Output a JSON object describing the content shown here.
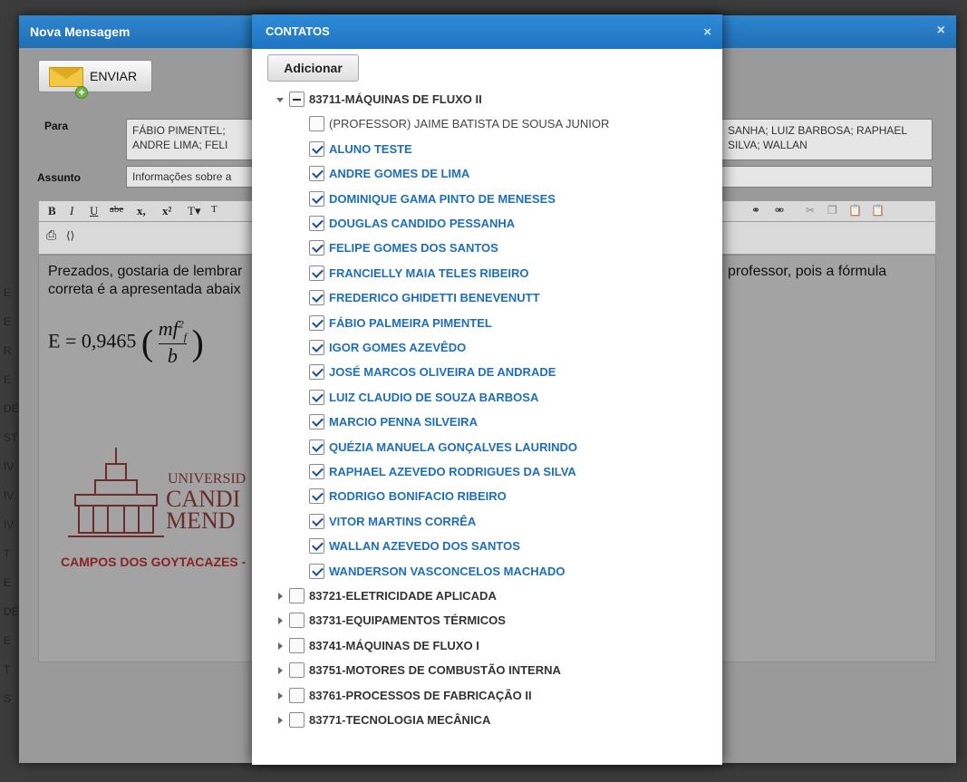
{
  "background": {
    "letters": [
      "E",
      "E",
      "R",
      "E",
      "DE",
      "ST",
      "IV",
      "IV",
      "IV",
      "T",
      "E",
      "DE",
      "E",
      "T",
      "S"
    ]
  },
  "compose": {
    "title": "Nova Mensagem",
    "close_icon": "×",
    "send_label": "ENVIAR",
    "to_label": "Para",
    "to_value_left": "FÁBIO PIMENTEL; ANDRE LIMA; FELI",
    "to_value_right": "SANHA; LUIZ BARBOSA; RAPHAEL SILVA; WALLAN",
    "subject_label": "Assunto",
    "subject_value": "Informações sobre a",
    "toolbar": [
      "B",
      "I",
      "U",
      "abe",
      "x,",
      "x²",
      "T▾",
      "T"
    ],
    "editor_line1_left": "Prezados, gostaria de lembrar",
    "editor_line1_right": "professor, pois a fórmula",
    "editor_line2": "correta é a apresentada abaix",
    "formula": "E = 0,9465",
    "logo_line1": "UNIVERSID",
    "logo_line2": "CANDI",
    "logo_line3": "MEND",
    "logo_campos": "CAMPOS  DOS GOYTACAZES -"
  },
  "contacts": {
    "title": "CONTATOS",
    "close_icon": "×",
    "add_label": "Adicionar",
    "groups": [
      {
        "label": "83711-MÁQUINAS DE FLUXO II",
        "expanded": true,
        "state": "partial",
        "members": [
          {
            "label": "(PROFESSOR) JAIME BATISTA DE SOUSA JUNIOR",
            "checked": false
          },
          {
            "label": "ALUNO TESTE",
            "checked": true
          },
          {
            "label": "ANDRE GOMES DE LIMA",
            "checked": true
          },
          {
            "label": "DOMINIQUE GAMA PINTO DE MENESES",
            "checked": true
          },
          {
            "label": "DOUGLAS CANDIDO PESSANHA",
            "checked": true
          },
          {
            "label": "FELIPE GOMES DOS SANTOS",
            "checked": true
          },
          {
            "label": "FRANCIELLY MAIA TELES RIBEIRO",
            "checked": true
          },
          {
            "label": "FREDERICO GHIDETTI BENEVENUTT",
            "checked": true
          },
          {
            "label": "FÁBIO PALMEIRA PIMENTEL",
            "checked": true
          },
          {
            "label": "IGOR GOMES AZEVÊDO",
            "checked": true
          },
          {
            "label": "JOSÉ MARCOS OLIVEIRA DE ANDRADE",
            "checked": true
          },
          {
            "label": "LUIZ CLAUDIO DE SOUZA BARBOSA",
            "checked": true
          },
          {
            "label": "MARCIO PENNA SILVEIRA",
            "checked": true
          },
          {
            "label": "QUÉZIA MANUELA GONÇALVES LAURINDO",
            "checked": true
          },
          {
            "label": "RAPHAEL AZEVEDO RODRIGUES DA SILVA",
            "checked": true
          },
          {
            "label": "RODRIGO BONIFACIO RIBEIRO",
            "checked": true
          },
          {
            "label": "VITOR MARTINS CORRÊA",
            "checked": true
          },
          {
            "label": "WALLAN AZEVEDO DOS SANTOS",
            "checked": true
          },
          {
            "label": "WANDERSON VASCONCELOS MACHADO",
            "checked": true
          }
        ]
      },
      {
        "label": "83721-ELETRICIDADE APLICADA",
        "expanded": false,
        "state": "unchecked",
        "members": []
      },
      {
        "label": "83731-EQUIPAMENTOS TÉRMICOS",
        "expanded": false,
        "state": "unchecked",
        "members": []
      },
      {
        "label": "83741-MÁQUINAS DE FLUXO I",
        "expanded": false,
        "state": "unchecked",
        "members": []
      },
      {
        "label": "83751-MOTORES DE COMBUSTÃO INTERNA",
        "expanded": false,
        "state": "unchecked",
        "members": []
      },
      {
        "label": "83761-PROCESSOS DE FABRICAÇÃO II",
        "expanded": false,
        "state": "unchecked",
        "members": []
      },
      {
        "label": "83771-TECNOLOGIA MECÂNICA",
        "expanded": false,
        "state": "unchecked",
        "members": []
      }
    ]
  }
}
